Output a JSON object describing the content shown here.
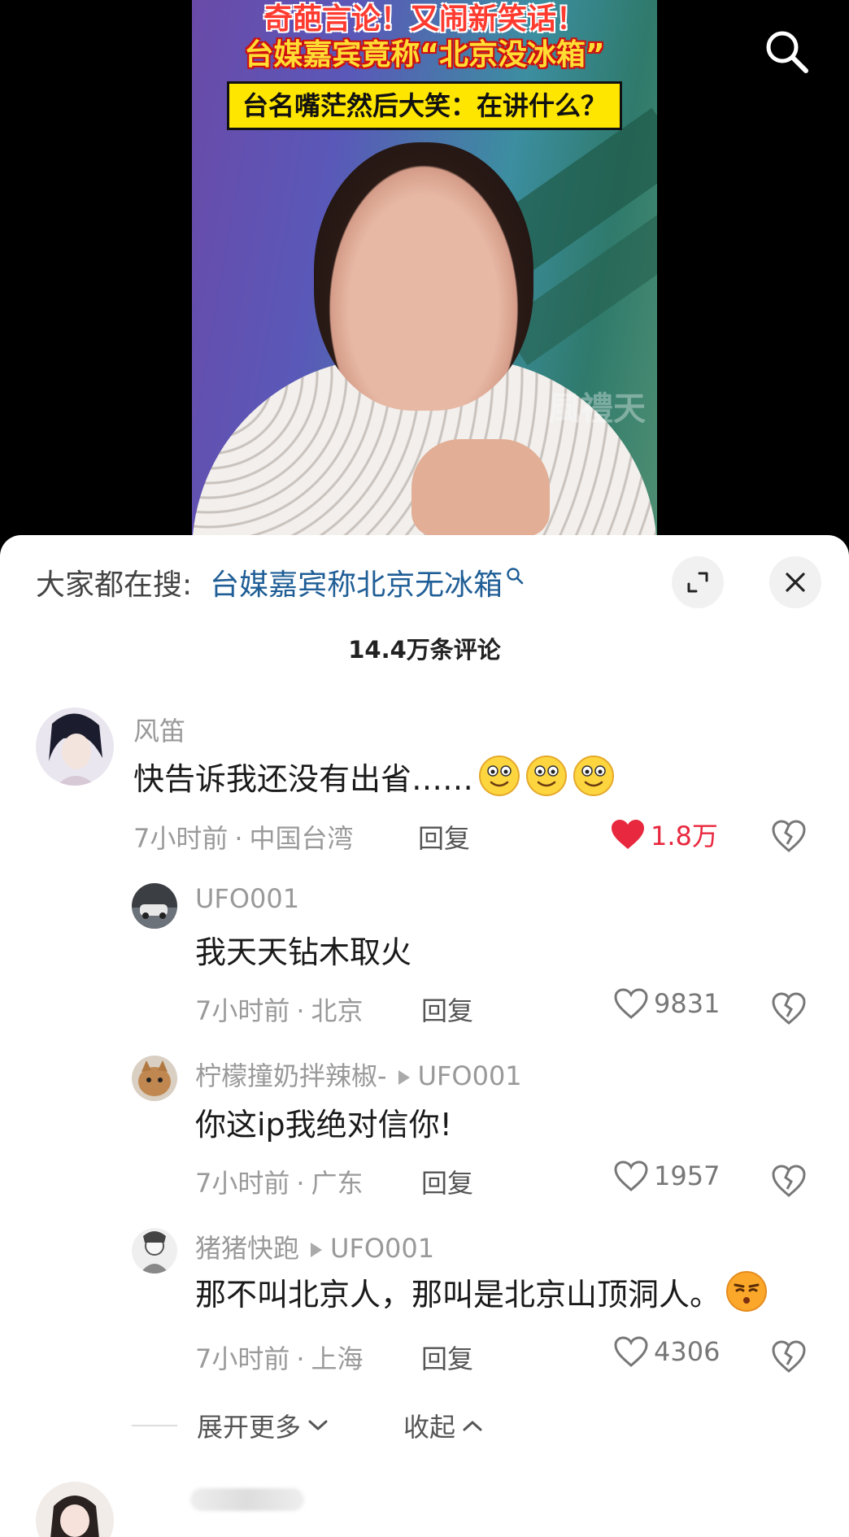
{
  "video": {
    "title_line1": "奇葩言论！又闹新笑话！",
    "title_line2": "台媒嘉宾竟称“北京没冰箱”",
    "title_line3": "台名嘴茫然后大笑：在讲什么？",
    "watermark": "風禮天"
  },
  "search": {
    "prefix": "大家都在搜:",
    "link": "台媒嘉宾称北京无冰箱"
  },
  "comment_count": "14.4万条评论",
  "comments": [
    {
      "user": "风笛",
      "text": "快告诉我还没有出省……",
      "time": "7小时前",
      "location": "中国台湾",
      "reply": "回复",
      "likes": "1.8万",
      "liked": true
    },
    {
      "user": "UFO001",
      "text": "我天天钻木取火",
      "time": "7小时前",
      "location": "北京",
      "reply": "回复",
      "likes": "9831"
    },
    {
      "user": "柠檬撞奶拌辣椒-",
      "reply_to": "UFO001",
      "text": "你这ip我绝对信你!",
      "time": "7小时前",
      "location": "广东",
      "reply": "回复",
      "likes": "1957"
    },
    {
      "user": "猪猪快跑",
      "reply_to": "UFO001",
      "text": "那不叫北京人，那叫是北京山顶洞人。",
      "time": "7小时前",
      "location": "上海",
      "reply": "回复",
      "likes": "4306"
    }
  ],
  "expand_more": "展开更多",
  "collapse": "收起",
  "meta_separator": "·",
  "colors": {
    "link": "#1f5e96",
    "liked": "#e8283f",
    "sheet_bg": "#ffffff"
  },
  "icons": [
    "search-icon",
    "expand-icon",
    "close-icon",
    "heart-icon",
    "broken-heart-icon",
    "chevron-down-icon",
    "chevron-up-icon"
  ]
}
